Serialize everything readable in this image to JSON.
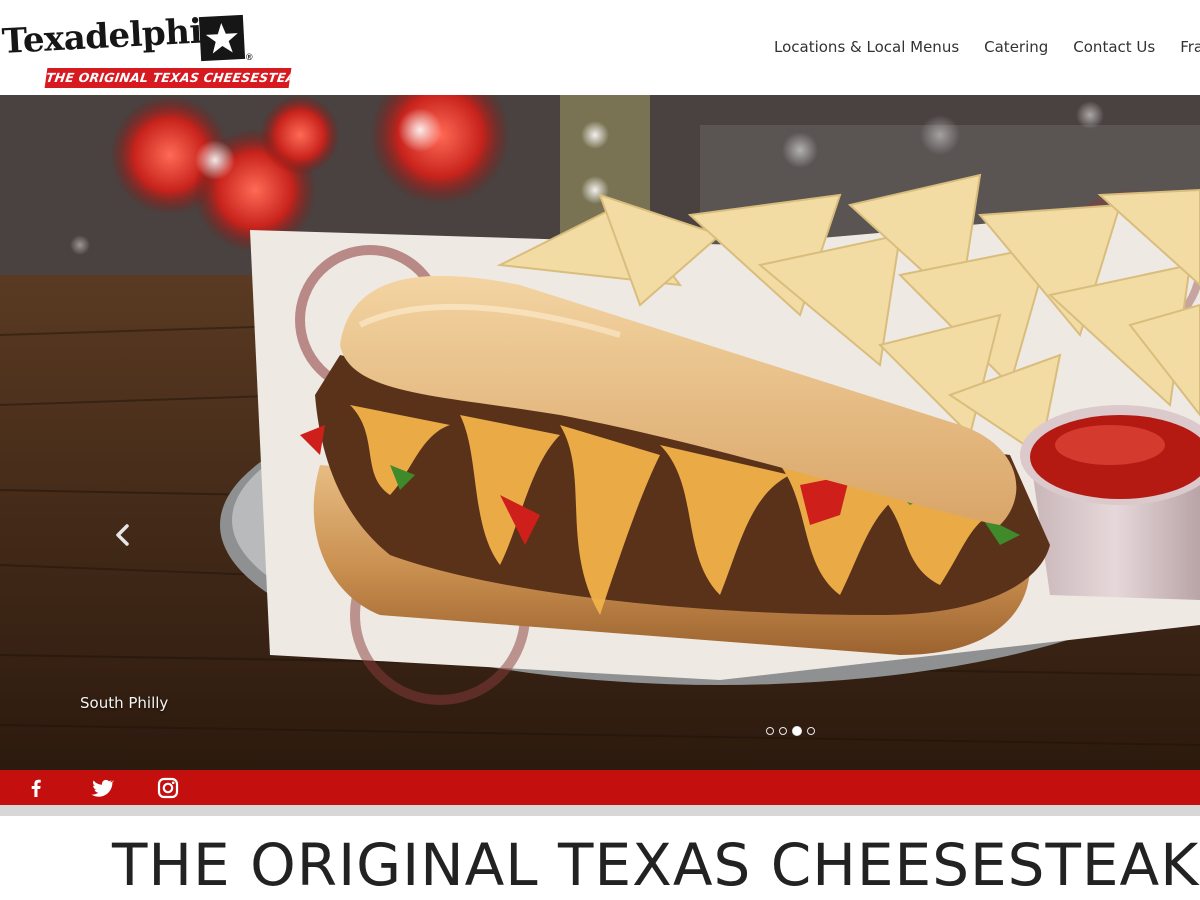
{
  "brand": {
    "name": "Texadelphia",
    "registered_mark": "®",
    "tagline": "THE ORIGINAL TEXAS CHEESESTEAK",
    "colors": {
      "red": "#d71920",
      "dark": "#161616"
    }
  },
  "nav": {
    "items": [
      {
        "label": "Locations & Local Menus"
      },
      {
        "label": "Catering"
      },
      {
        "label": "Contact Us"
      },
      {
        "label": "Franchising"
      }
    ]
  },
  "hero": {
    "caption": "South Philly",
    "prev_icon": "chevron-left-icon",
    "slide_count": 4,
    "active_slide": 3
  },
  "social": {
    "bar_color": "#c40f0f",
    "icons": [
      "facebook-icon",
      "twitter-icon",
      "instagram-icon"
    ]
  },
  "headline": "THE ORIGINAL TEXAS CHEESESTEAK"
}
